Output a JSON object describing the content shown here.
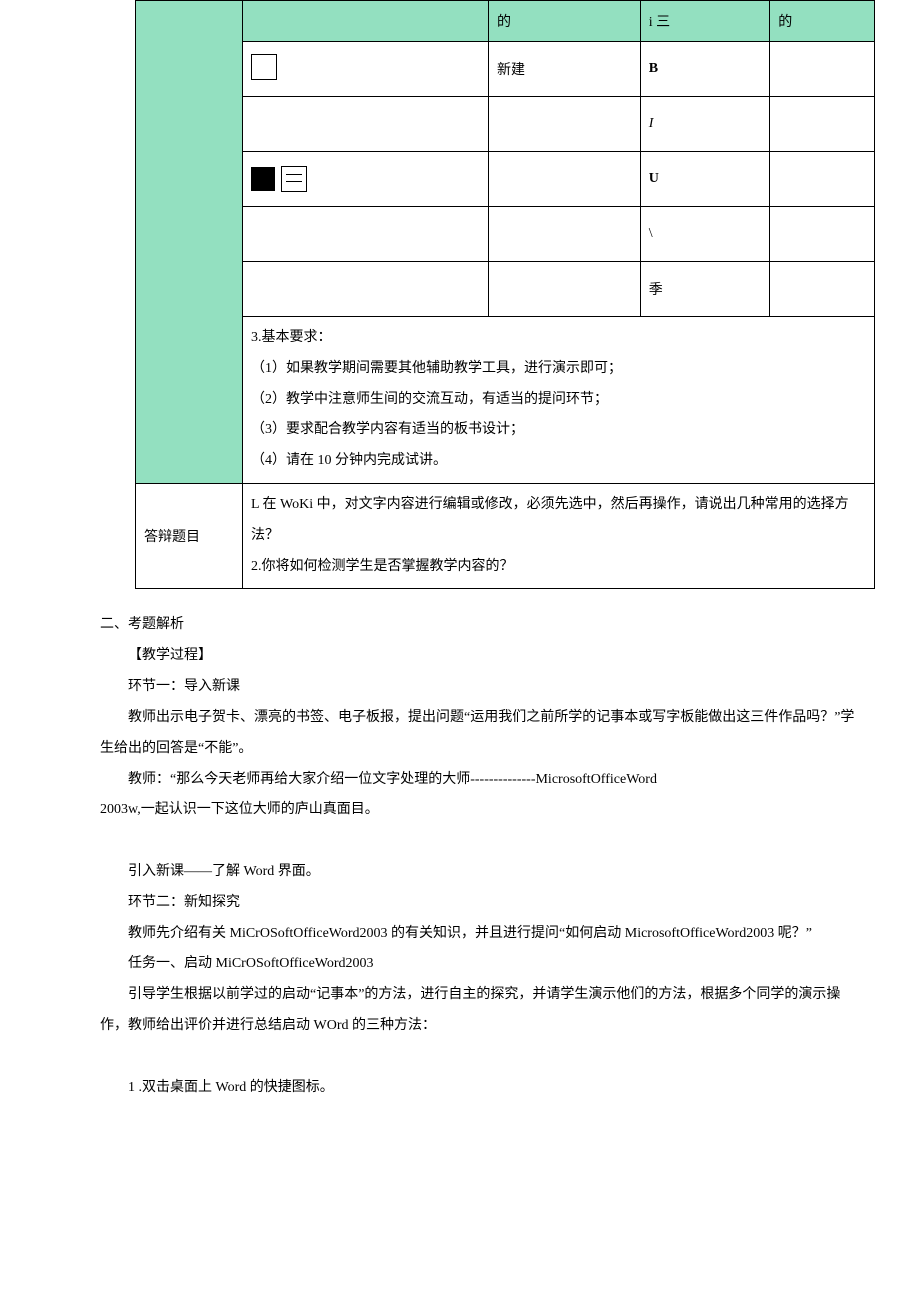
{
  "table": {
    "headers": [
      "",
      "的",
      "i 三",
      "的"
    ],
    "rows": [
      {
        "c1": "",
        "c2": "新建",
        "c3": "B",
        "c4": ""
      },
      {
        "c1": "",
        "c2": "",
        "c3": "I",
        "c4": ""
      },
      {
        "c1": "",
        "c2": "",
        "c3": "U",
        "c4": ""
      },
      {
        "c1": "",
        "c2": "",
        "c3": "\\",
        "c4": ""
      },
      {
        "c1": "",
        "c2": "",
        "c3": "季",
        "c4": ""
      }
    ],
    "requirements_title": "3.基本要求：",
    "requirements": [
      "（1）如果教学期间需要其他辅助教学工具，进行演示即可；",
      "（2）教学中注意师生间的交流互动，有适当的提问环节；",
      "（3）要求配合教学内容有适当的板书设计；",
      "（4）请在 10 分钟内完成试讲。"
    ],
    "defense_label": "答辩题目",
    "defense_q1": "L 在 WoKi 中，对文字内容进行编辑或修改，必须先选中，然后再操作，请说出几种常用的选择方法？",
    "defense_q2": "2.你将如何检测学生是否掌握教学内容的？"
  },
  "section2_title": "二、考题解析",
  "subtitle1": "【教学过程】",
  "p1": "环节一：导入新课",
  "p2": "教师出示电子贺卡、漂亮的书签、电子板报，提出问题“运用我们之前所学的记事本或写字板能做出这三件作品吗？”学生给出的回答是“不能”。",
  "p3": "教师：“那么今天老师再给大家介绍一位文字处理的大师--------------MicrosoftOfficeWord",
  "p3b": "2003w,一起认识一下这位大师的庐山真面目。",
  "p4": "引入新课——了解 Word 界面。",
  "p5": "环节二：新知探究",
  "p6": "教师先介绍有关 MiCrOSoftOfficeWord2003 的有关知识，并且进行提问“如何启动 MicrosoftOfficeWord2003 呢？”",
  "p7": "任务一、启动 MiCrOSoftOfficeWord2003",
  "p8": "引导学生根据以前学过的启动“记事本”的方法，进行自主的探究，并请学生演示他们的方法，根据多个同学的演示操作，教师给出评价并进行总结启动 WOrd 的三种方法：",
  "p9": "1 .双击桌面上 Word 的快捷图标。"
}
